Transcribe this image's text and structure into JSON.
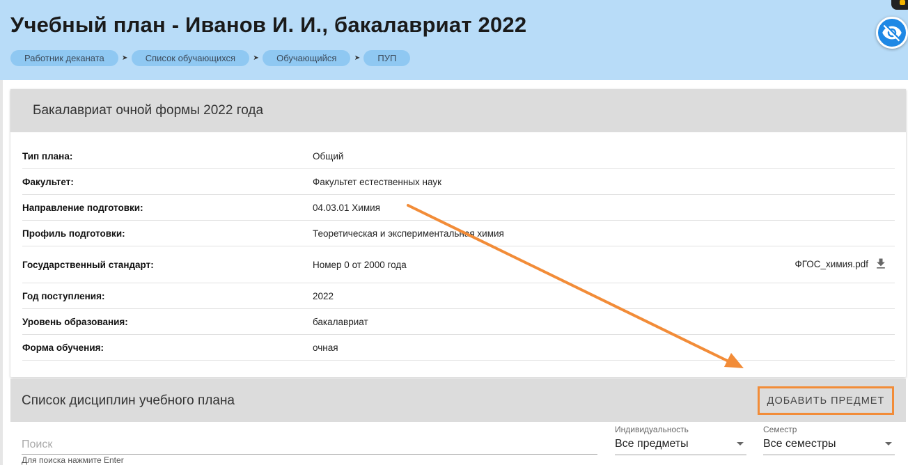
{
  "page": {
    "title": "Учебный план - Иванов И. И., бакалавриат 2022"
  },
  "breadcrumbs": [
    "Работник деканата",
    "Список обучающихся",
    "Обучающийся",
    "ПУП"
  ],
  "plan_card": {
    "header": "Бакалавриат очной формы 2022 года",
    "rows": [
      {
        "label": "Тип плана:",
        "value": "Общий"
      },
      {
        "label": "Факультет:",
        "value": "Факультет естественных наук"
      },
      {
        "label": "Направление подготовки:",
        "value": "04.03.01 Химия"
      },
      {
        "label": "Профиль подготовки:",
        "value": "Теоретическая и экспериментальная химия"
      },
      {
        "label": "Государственный стандарт:",
        "value": "Номер 0 от 2000 года",
        "file": "ФГОС_химия.pdf"
      },
      {
        "label": "Год поступления:",
        "value": "2022"
      },
      {
        "label": "Уровень образования:",
        "value": "бакалавриат"
      },
      {
        "label": "Форма обучения:",
        "value": "очная"
      }
    ]
  },
  "disciplines": {
    "title": "Список дисциплин учебного плана",
    "add_button": "ДОБАВИТЬ ПРЕДМЕТ"
  },
  "filters": {
    "search_placeholder": "Поиск",
    "search_hint": "Для поиска нажмите Enter",
    "individual": {
      "label": "Индивидуальность",
      "value": "Все предметы"
    },
    "semester": {
      "label": "Семестр",
      "value": "Все семестры"
    }
  },
  "icons": {
    "visibility_toggle": "eye-off-icon",
    "download": "download-icon",
    "breadcrumb_separator": "chevron-right-icon"
  },
  "colors": {
    "header_bg": "#b8dcf8",
    "crumb_bg": "#8fc8f2",
    "section_bg": "#dcdcdc",
    "fab_blue": "#1e88e5",
    "annotation_orange": "#f28c38"
  }
}
